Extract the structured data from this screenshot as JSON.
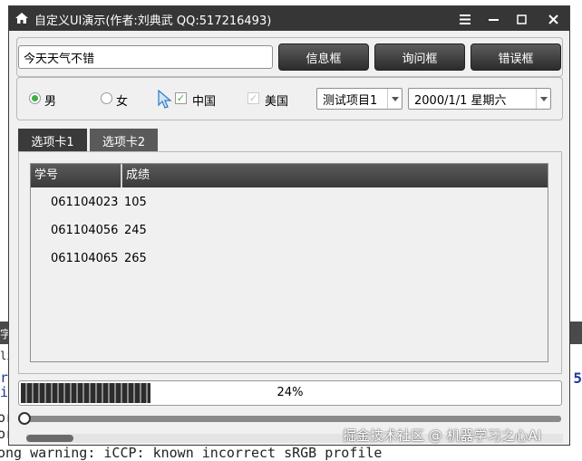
{
  "window": {
    "title": "自定义UI演示(作者:刘典武 QQ:517216493)"
  },
  "toolbar": {
    "text_input_value": "今天天气不错",
    "buttons": [
      "信息框",
      "询问框",
      "错误框"
    ]
  },
  "options": {
    "radios": [
      {
        "label": "男",
        "checked": true
      },
      {
        "label": "女",
        "checked": false
      }
    ],
    "checkboxes": [
      {
        "label": "中国",
        "checked": true,
        "enabled": true
      },
      {
        "label": "美国",
        "checked": true,
        "enabled": false
      }
    ],
    "combo_value": "测试项目1",
    "date_value": "2000/1/1 星期六"
  },
  "tabs": [
    "选项卡1",
    "选项卡2"
  ],
  "table": {
    "headers": [
      "学号",
      "成绩"
    ],
    "rows": [
      [
        "061104023",
        "105"
      ],
      [
        "061104056",
        "245"
      ],
      [
        "061104065",
        "265"
      ]
    ]
  },
  "progress": {
    "value": 24,
    "text": "24%"
  },
  "slider": {
    "value": 0
  },
  "background": {
    "terminal_text": "ong warning: iCCP: known incorrect sRGB profile",
    "terminal_frag_1": "字",
    "terminal_frag_2": "li",
    "terminal_frag_3": "r",
    "terminal_frag_4": "i",
    "terminal_frag_5": "or",
    "terminal_frag_6": "or",
    "right_num": "5"
  },
  "watermark": "掘金技术社区 @ 机器学习之心AI",
  "colors": {
    "titlebar": "#363636",
    "button_dark": "#2c2c2c",
    "accent_green": "#3cb045"
  }
}
